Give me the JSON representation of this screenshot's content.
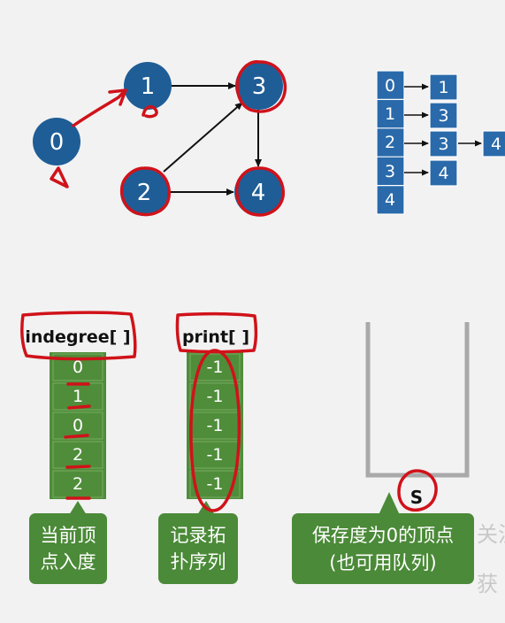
{
  "colors": {
    "node_fill": "#1f5d96",
    "adj_fill": "#2a6aaa",
    "table_fill": "#4f8d3a",
    "callout_fill": "#4b8a38",
    "annotation": "#d0121a",
    "edge": "#111111"
  },
  "graph": {
    "nodes": [
      {
        "id": "0",
        "label": "0"
      },
      {
        "id": "1",
        "label": "1"
      },
      {
        "id": "2",
        "label": "2"
      },
      {
        "id": "3",
        "label": "3"
      },
      {
        "id": "4",
        "label": "4"
      }
    ],
    "edges": [
      {
        "from": "0",
        "to": "1"
      },
      {
        "from": "1",
        "to": "3"
      },
      {
        "from": "2",
        "to": "3"
      },
      {
        "from": "2",
        "to": "4"
      },
      {
        "from": "3",
        "to": "4"
      }
    ]
  },
  "adjacency_list": {
    "heads": [
      "0",
      "1",
      "2",
      "3",
      "4"
    ],
    "lists": [
      [
        "1"
      ],
      [
        "3"
      ],
      [
        "3",
        "4"
      ],
      [
        "4"
      ],
      []
    ]
  },
  "indegree_table": {
    "header": "indegree[ ]",
    "values": [
      "0",
      "1",
      "0",
      "2",
      "2"
    ],
    "caption_line1": "当前顶",
    "caption_line2": "点入度"
  },
  "print_table": {
    "header": "print[ ]",
    "values": [
      "-1",
      "-1",
      "-1",
      "-1",
      "-1"
    ],
    "caption_line1": "记录拓",
    "caption_line2": "扑序列"
  },
  "stack": {
    "label": "S",
    "caption_line1": "保存度为0的顶点",
    "caption_line2": "(也可用队列)"
  },
  "watermark": {
    "line1": "关注",
    "line2": "获"
  }
}
